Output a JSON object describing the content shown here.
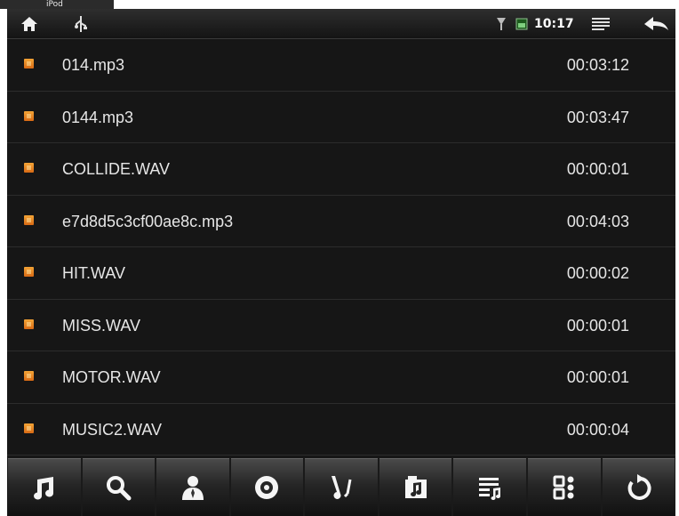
{
  "top_tab": {
    "label": "iPod"
  },
  "status_bar": {
    "home_icon": "home-icon",
    "usb_icon": "usb-icon",
    "signal_icon": "signal-icon",
    "battery_icon": "battery-icon",
    "time": "10:17",
    "menu_icon": "menu-icon",
    "back_icon": "back-arrow-icon"
  },
  "files": [
    {
      "name": "014.mp3",
      "duration": "00:03:12"
    },
    {
      "name": "0144.mp3",
      "duration": "00:03:47"
    },
    {
      "name": "COLLIDE.WAV",
      "duration": "00:00:01"
    },
    {
      "name": "e7d8d5c3cf00ae8c.mp3",
      "duration": "00:04:03"
    },
    {
      "name": "HIT.WAV",
      "duration": "00:00:02"
    },
    {
      "name": "MISS.WAV",
      "duration": "00:00:01"
    },
    {
      "name": "MOTOR.WAV",
      "duration": "00:00:01"
    },
    {
      "name": "MUSIC2.WAV",
      "duration": "00:00:04"
    }
  ],
  "toolbar": {
    "icons": [
      "music-note-icon",
      "search-icon",
      "artist-icon",
      "disc-icon",
      "genre-icon",
      "folder-music-icon",
      "playlist-icon",
      "grid-menu-icon",
      "repeat-icon"
    ]
  },
  "colors": {
    "file_icon": "#e8862a",
    "background": "#161616",
    "text": "#e6e6e6"
  }
}
